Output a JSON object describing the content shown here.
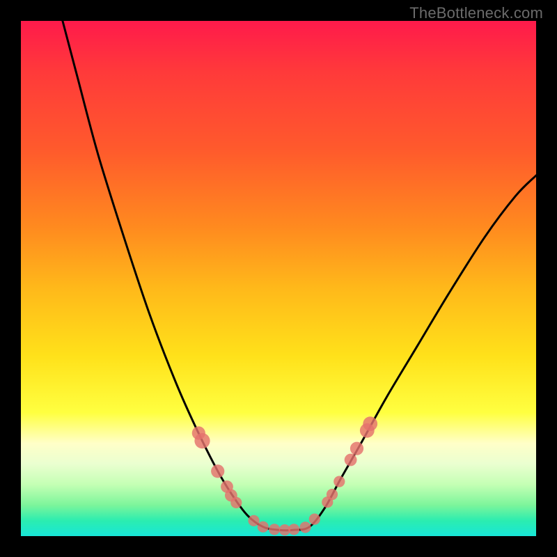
{
  "watermark": "TheBottleneck.com",
  "colors": {
    "frame": "#000000",
    "curve": "#000000",
    "marker": "#e4716c",
    "gradient_stops": [
      {
        "pos": 0.0,
        "hex": "#ff1a4b"
      },
      {
        "pos": 0.1,
        "hex": "#ff3a3a"
      },
      {
        "pos": 0.25,
        "hex": "#ff5a2c"
      },
      {
        "pos": 0.4,
        "hex": "#ff8a1f"
      },
      {
        "pos": 0.52,
        "hex": "#ffb91a"
      },
      {
        "pos": 0.65,
        "hex": "#ffe11a"
      },
      {
        "pos": 0.76,
        "hex": "#ffff40"
      },
      {
        "pos": 0.82,
        "hex": "#ffffc8"
      },
      {
        "pos": 0.86,
        "hex": "#eaffd0"
      },
      {
        "pos": 0.9,
        "hex": "#c4ffb4"
      },
      {
        "pos": 0.94,
        "hex": "#7cf59b"
      },
      {
        "pos": 0.97,
        "hex": "#2bedb0"
      },
      {
        "pos": 1.0,
        "hex": "#18e6d8"
      }
    ]
  },
  "chart_data": {
    "type": "line",
    "title": "",
    "xlabel": "",
    "ylabel": "",
    "xlim": [
      0,
      1
    ],
    "ylim": [
      0,
      1
    ],
    "note": "Axes are unlabeled; values are normalized to the plot area width/height.",
    "series": [
      {
        "name": "curve",
        "points": [
          {
            "x": 0.081,
            "y": 1.0
          },
          {
            "x": 0.11,
            "y": 0.89
          },
          {
            "x": 0.15,
            "y": 0.74
          },
          {
            "x": 0.2,
            "y": 0.58
          },
          {
            "x": 0.25,
            "y": 0.43
          },
          {
            "x": 0.3,
            "y": 0.3
          },
          {
            "x": 0.34,
            "y": 0.21
          },
          {
            "x": 0.38,
            "y": 0.13
          },
          {
            "x": 0.41,
            "y": 0.08
          },
          {
            "x": 0.44,
            "y": 0.04
          },
          {
            "x": 0.47,
            "y": 0.018
          },
          {
            "x": 0.5,
            "y": 0.012
          },
          {
            "x": 0.53,
            "y": 0.012
          },
          {
            "x": 0.56,
            "y": 0.018
          },
          {
            "x": 0.59,
            "y": 0.055
          },
          {
            "x": 0.62,
            "y": 0.11
          },
          {
            "x": 0.66,
            "y": 0.18
          },
          {
            "x": 0.71,
            "y": 0.27
          },
          {
            "x": 0.77,
            "y": 0.37
          },
          {
            "x": 0.83,
            "y": 0.47
          },
          {
            "x": 0.9,
            "y": 0.58
          },
          {
            "x": 0.96,
            "y": 0.66
          },
          {
            "x": 1.0,
            "y": 0.7
          }
        ]
      }
    ],
    "markers": [
      {
        "x": 0.345,
        "y": 0.2,
        "r": 0.013
      },
      {
        "x": 0.352,
        "y": 0.185,
        "r": 0.015
      },
      {
        "x": 0.382,
        "y": 0.126,
        "r": 0.013
      },
      {
        "x": 0.4,
        "y": 0.096,
        "r": 0.012
      },
      {
        "x": 0.408,
        "y": 0.079,
        "r": 0.012
      },
      {
        "x": 0.418,
        "y": 0.065,
        "r": 0.011
      },
      {
        "x": 0.452,
        "y": 0.03,
        "r": 0.011
      },
      {
        "x": 0.47,
        "y": 0.018,
        "r": 0.011
      },
      {
        "x": 0.492,
        "y": 0.013,
        "r": 0.011
      },
      {
        "x": 0.512,
        "y": 0.012,
        "r": 0.011
      },
      {
        "x": 0.53,
        "y": 0.013,
        "r": 0.011
      },
      {
        "x": 0.552,
        "y": 0.017,
        "r": 0.011
      },
      {
        "x": 0.57,
        "y": 0.033,
        "r": 0.011
      },
      {
        "x": 0.595,
        "y": 0.066,
        "r": 0.011
      },
      {
        "x": 0.604,
        "y": 0.081,
        "r": 0.011
      },
      {
        "x": 0.618,
        "y": 0.106,
        "r": 0.011
      },
      {
        "x": 0.64,
        "y": 0.148,
        "r": 0.012
      },
      {
        "x": 0.652,
        "y": 0.17,
        "r": 0.013
      },
      {
        "x": 0.672,
        "y": 0.205,
        "r": 0.014
      },
      {
        "x": 0.678,
        "y": 0.218,
        "r": 0.014
      }
    ]
  }
}
